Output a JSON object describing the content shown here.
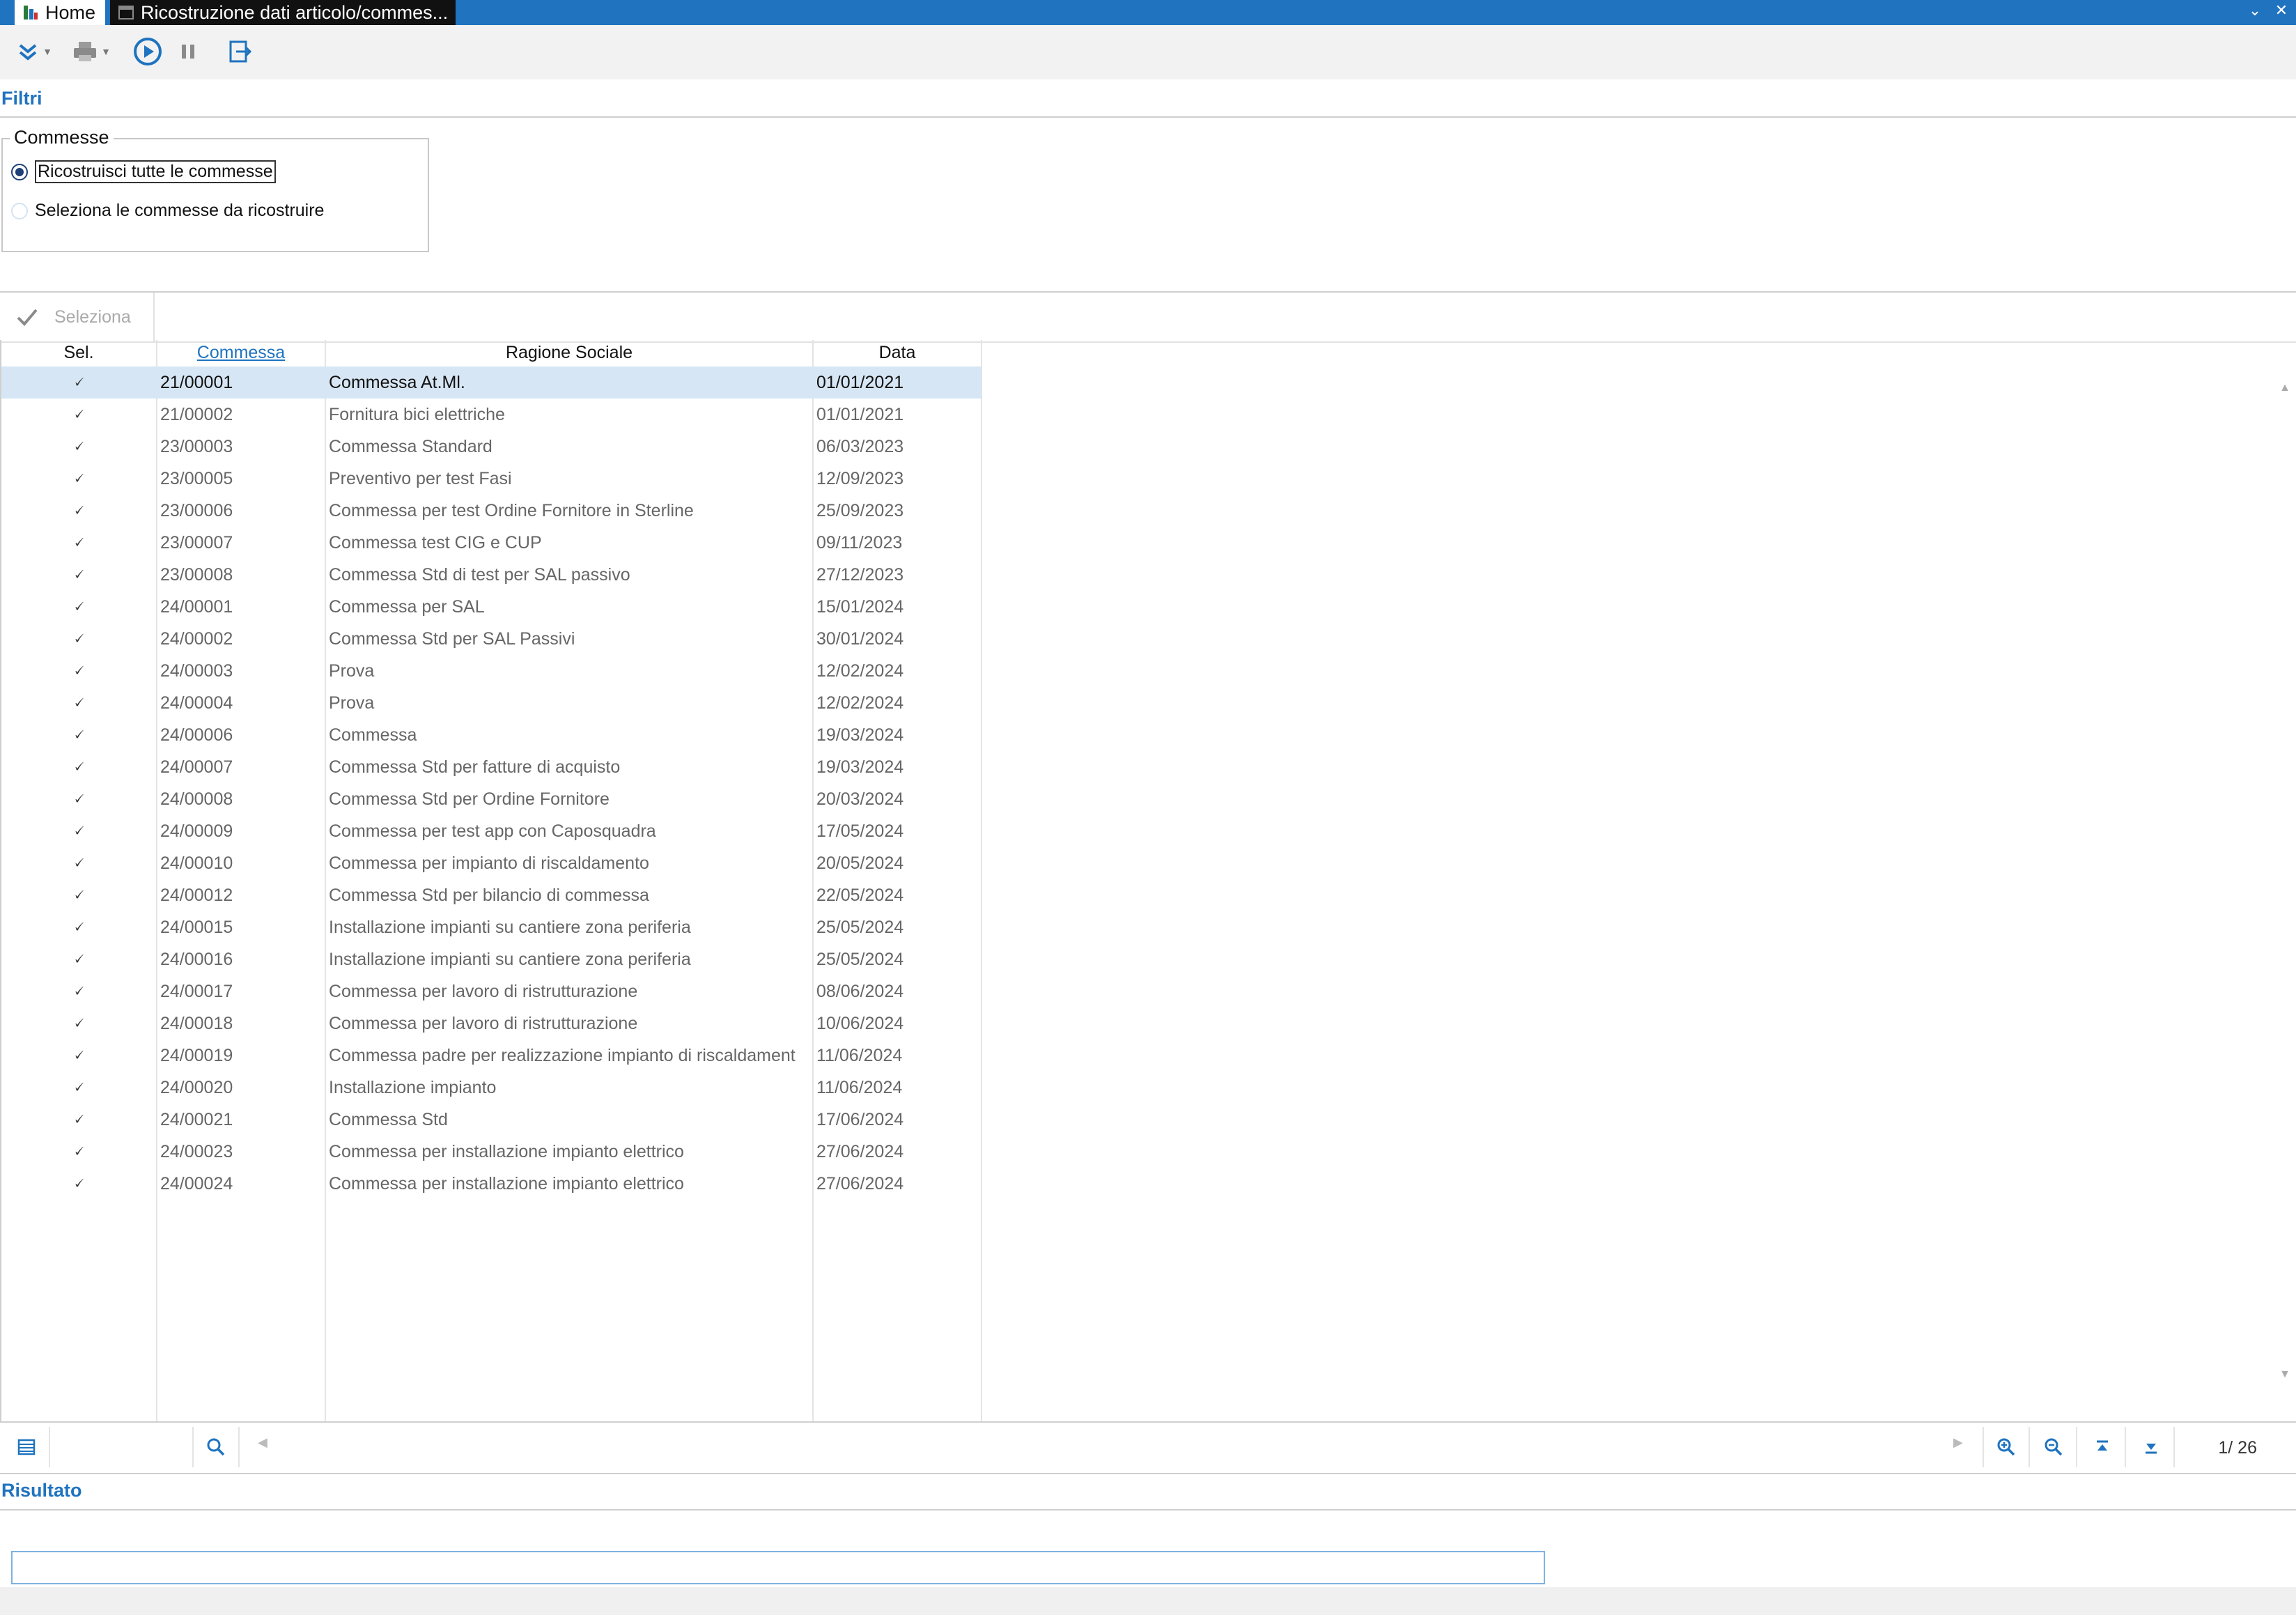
{
  "window": {
    "tabs": [
      {
        "label": "Home"
      },
      {
        "label": "Ricostruzione dati articolo/commes..."
      }
    ]
  },
  "colors": {
    "accent": "#1f73bf",
    "selected_row": "#d7e6f4"
  },
  "filters": {
    "section_label": "Filtri",
    "group_title": "Commesse",
    "options": [
      {
        "label": "Ricostruisci tutte le commesse",
        "checked": true
      },
      {
        "label": "Seleziona le commesse da ricostruire",
        "checked": false
      }
    ]
  },
  "grid_toolbar": {
    "select_label": "Seleziona"
  },
  "table": {
    "headers": [
      "Sel.",
      "Commessa",
      "Ragione Sociale",
      "Data"
    ],
    "check_mark": "🗸",
    "rows": [
      {
        "commessa": "21/00001",
        "ragione": "Commessa At.Ml.",
        "data": "01/01/2021"
      },
      {
        "commessa": "21/00002",
        "ragione": "Fornitura bici elettriche",
        "data": "01/01/2021"
      },
      {
        "commessa": "23/00003",
        "ragione": "Commessa Standard",
        "data": "06/03/2023"
      },
      {
        "commessa": "23/00005",
        "ragione": "Preventivo per test Fasi",
        "data": "12/09/2023"
      },
      {
        "commessa": "23/00006",
        "ragione": "Commessa per test Ordine Fornitore in Sterline",
        "data": "25/09/2023"
      },
      {
        "commessa": "23/00007",
        "ragione": "Commessa test CIG e CUP",
        "data": "09/11/2023"
      },
      {
        "commessa": "23/00008",
        "ragione": "Commessa Std di test per SAL passivo",
        "data": "27/12/2023"
      },
      {
        "commessa": "24/00001",
        "ragione": "Commessa per SAL",
        "data": "15/01/2024"
      },
      {
        "commessa": "24/00002",
        "ragione": "Commessa Std per SAL Passivi",
        "data": "30/01/2024"
      },
      {
        "commessa": "24/00003",
        "ragione": "Prova",
        "data": "12/02/2024"
      },
      {
        "commessa": "24/00004",
        "ragione": "Prova",
        "data": "12/02/2024"
      },
      {
        "commessa": "24/00006",
        "ragione": "Commessa",
        "data": "19/03/2024"
      },
      {
        "commessa": "24/00007",
        "ragione": "Commessa Std per fatture di acquisto",
        "data": "19/03/2024"
      },
      {
        "commessa": "24/00008",
        "ragione": "Commessa Std per Ordine Fornitore",
        "data": "20/03/2024"
      },
      {
        "commessa": "24/00009",
        "ragione": "Commessa per test app con Caposquadra",
        "data": "17/05/2024"
      },
      {
        "commessa": "24/00010",
        "ragione": "Commessa per impianto di riscaldamento",
        "data": "20/05/2024"
      },
      {
        "commessa": "24/00012",
        "ragione": "Commessa Std per bilancio di commessa",
        "data": "22/05/2024"
      },
      {
        "commessa": "24/00015",
        "ragione": "Installazione impianti su cantiere zona periferia",
        "data": "25/05/2024"
      },
      {
        "commessa": "24/00016",
        "ragione": "Installazione impianti su cantiere zona periferia",
        "data": "25/05/2024"
      },
      {
        "commessa": "24/00017",
        "ragione": "Commessa per lavoro di ristrutturazione",
        "data": "08/06/2024"
      },
      {
        "commessa": "24/00018",
        "ragione": "Commessa per lavoro di ristrutturazione",
        "data": "10/06/2024"
      },
      {
        "commessa": "24/00019",
        "ragione": "Commessa padre per realizzazione impianto di riscaldament",
        "data": "11/06/2024"
      },
      {
        "commessa": "24/00020",
        "ragione": "Installazione impianto",
        "data": "11/06/2024"
      },
      {
        "commessa": "24/00021",
        "ragione": "Commessa Std",
        "data": "17/06/2024"
      },
      {
        "commessa": "24/00023",
        "ragione": "Commessa per installazione impianto elettrico",
        "data": "27/06/2024"
      },
      {
        "commessa": "24/00024",
        "ragione": "Commessa per installazione impianto elettrico",
        "data": "27/06/2024"
      }
    ]
  },
  "pager": {
    "text": "1/  26"
  },
  "result": {
    "section_label": "Risultato",
    "value": ""
  }
}
